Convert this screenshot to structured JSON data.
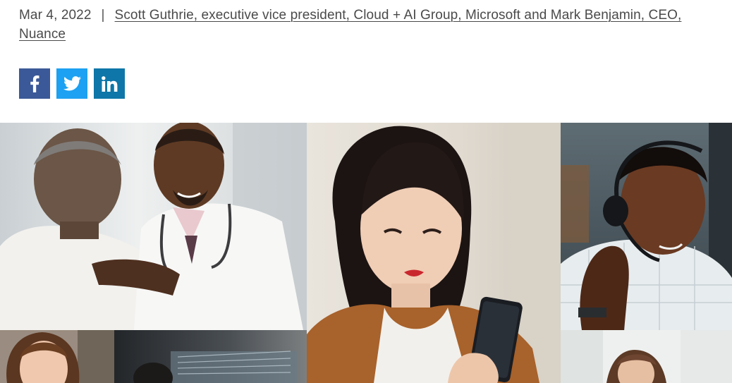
{
  "meta": {
    "date": "Mar 4, 2022",
    "separator": "|",
    "authors": "Scott Guthrie, executive vice president, Cloud + AI Group, Microsoft and Mark Benjamin, CEO, Nuance"
  },
  "share": {
    "items": [
      {
        "name": "facebook",
        "icon": "facebook-icon",
        "color": "#3b5998"
      },
      {
        "name": "twitter",
        "icon": "twitter-icon",
        "color": "#1da1f2"
      },
      {
        "name": "linkedin",
        "icon": "linkedin-icon",
        "color": "#0e76a8"
      }
    ]
  },
  "hero": {
    "tiles": [
      {
        "subject": "doctor-with-patient-photo"
      },
      {
        "subject": "woman-with-smartphone-photo"
      },
      {
        "subject": "agent-with-headset-photo"
      },
      {
        "subject": "woman-smiling-photo"
      },
      {
        "subject": "person-at-monitors-photo"
      },
      {
        "subject": "woman-at-desk-photo"
      }
    ]
  }
}
